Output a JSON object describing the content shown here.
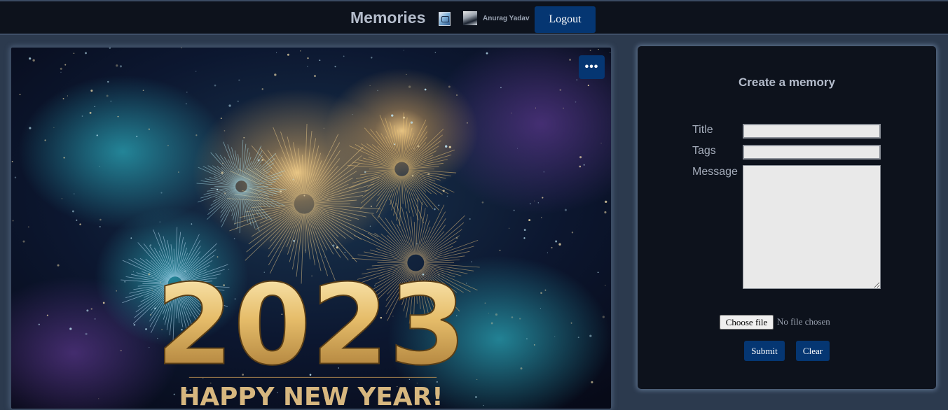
{
  "header": {
    "title": "Memories",
    "user_name": "Anurag Yadav",
    "logout_label": "Logout",
    "logo_icon": "memories-logo-icon",
    "avatar_icon": "user-avatar"
  },
  "memory_card": {
    "image_year": "2023",
    "image_caption": "HAPPY NEW YEAR!",
    "menu_label": "•••",
    "menu_icon": "more-options-icon"
  },
  "form": {
    "heading": "Create a memory",
    "title_label": "Title",
    "title_value": "",
    "tags_label": "Tags",
    "tags_value": "",
    "message_label": "Message",
    "message_value": "",
    "file_button_label": "Choose file",
    "file_status": "No file chosen",
    "submit_label": "Submit",
    "clear_label": "Clear"
  },
  "colors": {
    "accent": "#053672",
    "page_background": "#2c3a4e",
    "bar_background": "#0d121c"
  }
}
